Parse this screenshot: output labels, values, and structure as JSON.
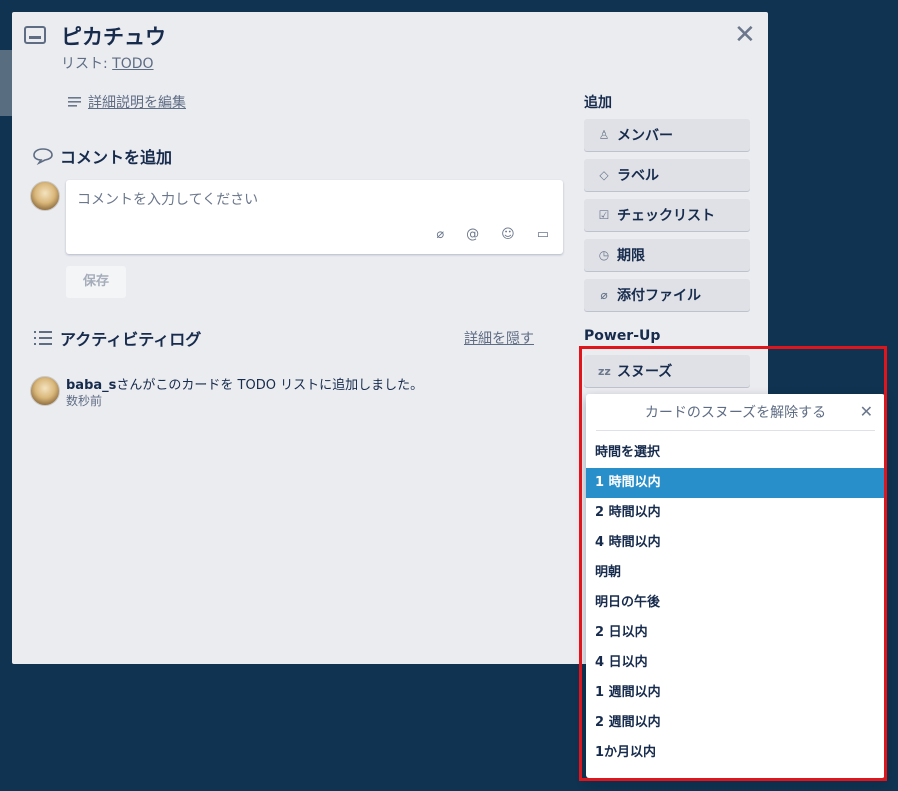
{
  "card": {
    "title": "ピカチュウ",
    "list_prefix": "リスト: ",
    "list_name": "TODO",
    "edit_description": "詳細説明を編集"
  },
  "comment": {
    "heading": "コメントを追加",
    "placeholder": "コメントを入力してください",
    "save_label": "保存"
  },
  "activity": {
    "heading": "アクティビティログ",
    "hide_details": "詳細を隠す",
    "entries": [
      {
        "user": "baba_s",
        "text": "さんがこのカードを TODO リストに追加しました。",
        "time": "数秒前"
      }
    ]
  },
  "sidebar": {
    "add_heading": "追加",
    "add_buttons": [
      {
        "label": "メンバー",
        "icon": "person-icon"
      },
      {
        "label": "ラベル",
        "icon": "tag-icon"
      },
      {
        "label": "チェックリスト",
        "icon": "checkbox-icon"
      },
      {
        "label": "期限",
        "icon": "clock-icon"
      },
      {
        "label": "添付ファイル",
        "icon": "paperclip-icon"
      }
    ],
    "powerup_heading": "Power-Up",
    "snooze_label": "スヌーズ",
    "snooze_icon_text": "zz"
  },
  "snooze_popover": {
    "title": "カードのスヌーズを解除する",
    "items": [
      "時間を選択",
      "1 時間以内",
      "2 時間以内",
      "4 時間以内",
      "明朝",
      "明日の午後",
      "2 日以内",
      "4 日以内",
      "1 週間以内",
      "2 週間以内",
      "1か月以内"
    ],
    "selected_index": 1
  },
  "colors": {
    "background": "#0f3350",
    "card": "#ebecf0",
    "selected": "#298fca",
    "highlight": "#e0151b"
  }
}
